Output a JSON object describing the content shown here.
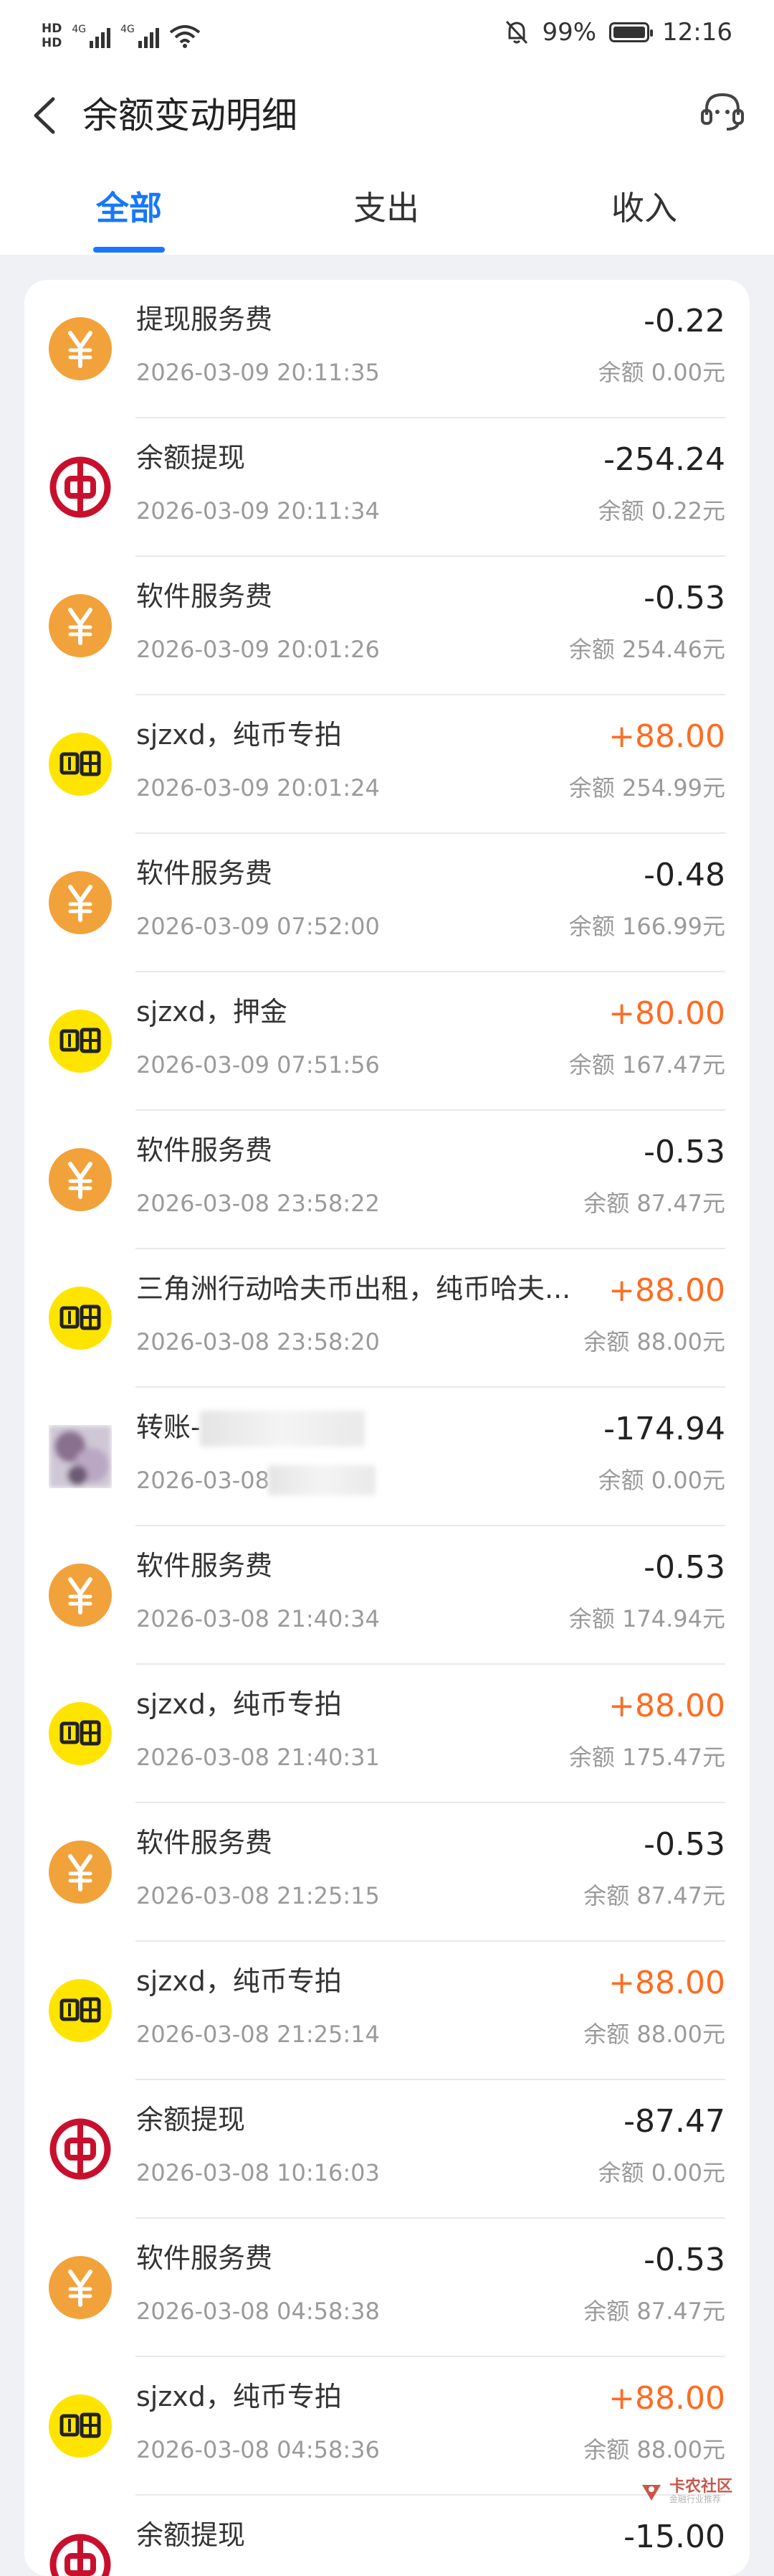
{
  "status_bar": {
    "hd1": "HD",
    "hd2": "HD",
    "net1": "4G",
    "net2": "4G",
    "battery_percent": "99%",
    "time": "12:16",
    "battery_level": 0.99
  },
  "header": {
    "title": "余额变动明细"
  },
  "tabs": [
    {
      "label": "全部",
      "active": true
    },
    {
      "label": "支出",
      "active": false
    },
    {
      "label": "收入",
      "active": false
    }
  ],
  "colors": {
    "accent": "#1677ff",
    "income": "#ff6b21",
    "yuan_icon": "#f2a23a",
    "bank_icon": "#c8102e",
    "xianyu_icon": "#ffe400"
  },
  "transactions": [
    {
      "icon": "yuan-coin-icon",
      "name": "提现服务费",
      "time": "2026-03-09 20:11:35",
      "amount": "-0.22",
      "balance": "余额 0.00元",
      "income": false
    },
    {
      "icon": "bank-of-china-icon",
      "name": "余额提现",
      "time": "2026-03-09 20:11:34",
      "amount": "-254.24",
      "balance": "余额 0.22元",
      "income": false
    },
    {
      "icon": "yuan-coin-icon",
      "name": "软件服务费",
      "time": "2026-03-09 20:01:26",
      "amount": "-0.53",
      "balance": "余额 254.46元",
      "income": false
    },
    {
      "icon": "xianyu-icon",
      "name": "sjzxd，纯币专拍",
      "time": "2026-03-09 20:01:24",
      "amount": "+88.00",
      "balance": "余额 254.99元",
      "income": true
    },
    {
      "icon": "yuan-coin-icon",
      "name": "软件服务费",
      "time": "2026-03-09 07:52:00",
      "amount": "-0.48",
      "balance": "余额 166.99元",
      "income": false
    },
    {
      "icon": "xianyu-icon",
      "name": "sjzxd，押金",
      "time": "2026-03-09 07:51:56",
      "amount": "+80.00",
      "balance": "余额 167.47元",
      "income": true
    },
    {
      "icon": "yuan-coin-icon",
      "name": "软件服务费",
      "time": "2026-03-08 23:58:22",
      "amount": "-0.53",
      "balance": "余额 87.47元",
      "income": false
    },
    {
      "icon": "xianyu-icon",
      "name": "三角洲行动哈夫币出租，纯币哈夫...",
      "time": "2026-03-08 23:58:20",
      "amount": "+88.00",
      "balance": "余额 88.00元",
      "income": true
    },
    {
      "icon": "user-avatar-icon",
      "name": "转账-",
      "time": "2026-03-08 2",
      "amount": "-174.94",
      "balance": "余额 0.00元",
      "income": false,
      "redacted": true
    },
    {
      "icon": "yuan-coin-icon",
      "name": "软件服务费",
      "time": "2026-03-08 21:40:34",
      "amount": "-0.53",
      "balance": "余额 174.94元",
      "income": false
    },
    {
      "icon": "xianyu-icon",
      "name": "sjzxd，纯币专拍",
      "time": "2026-03-08 21:40:31",
      "amount": "+88.00",
      "balance": "余额 175.47元",
      "income": true
    },
    {
      "icon": "yuan-coin-icon",
      "name": "软件服务费",
      "time": "2026-03-08 21:25:15",
      "amount": "-0.53",
      "balance": "余额 87.47元",
      "income": false
    },
    {
      "icon": "xianyu-icon",
      "name": "sjzxd，纯币专拍",
      "time": "2026-03-08 21:25:14",
      "amount": "+88.00",
      "balance": "余额 88.00元",
      "income": true
    },
    {
      "icon": "bank-of-china-icon",
      "name": "余额提现",
      "time": "2026-03-08 10:16:03",
      "amount": "-87.47",
      "balance": "余额 0.00元",
      "income": false
    },
    {
      "icon": "yuan-coin-icon",
      "name": "软件服务费",
      "time": "2026-03-08 04:58:38",
      "amount": "-0.53",
      "balance": "余额 87.47元",
      "income": false
    },
    {
      "icon": "xianyu-icon",
      "name": "sjzxd，纯币专拍",
      "time": "2026-03-08 04:58:36",
      "amount": "+88.00",
      "balance": "余额 88.00元",
      "income": true
    },
    {
      "icon": "bank-of-china-icon",
      "name": "余额提现",
      "time": "",
      "amount": "-15.00",
      "balance": "",
      "income": false
    }
  ],
  "watermark": {
    "main": "卡农社区",
    "sub": "金融行业推荐"
  }
}
